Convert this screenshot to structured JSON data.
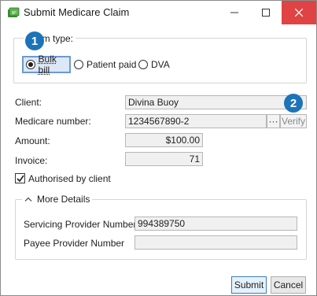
{
  "window": {
    "title": "Submit Medicare Claim"
  },
  "claim_type": {
    "legend": "Claim type:",
    "options": [
      {
        "label": "Bulk bill",
        "selected": true
      },
      {
        "label": "Patient paid",
        "selected": false
      },
      {
        "label": "DVA",
        "selected": false
      }
    ]
  },
  "badges": {
    "one": "1",
    "two": "2"
  },
  "form": {
    "client_label": "Client:",
    "client_value": "Divina Buoy",
    "medicare_label": "Medicare number:",
    "medicare_value": "1234567890-2",
    "ellipsis_label": "···",
    "verify_label": "Verify",
    "amount_label": "Amount:",
    "amount_value": "$100.00",
    "invoice_label": "Invoice:",
    "invoice_value": "71",
    "authorised_label": "Authorised by client",
    "authorised_checked": true
  },
  "details": {
    "legend": "More Details",
    "servicing_label": "Servicing Provider Number",
    "servicing_value": "994389750",
    "payee_label": "Payee Provider Number",
    "payee_value": ""
  },
  "buttons": {
    "submit": "Submit",
    "cancel": "Cancel"
  },
  "colors": {
    "badge": "#1d73b8",
    "close": "#e04343",
    "selection": "#dde8f6"
  }
}
